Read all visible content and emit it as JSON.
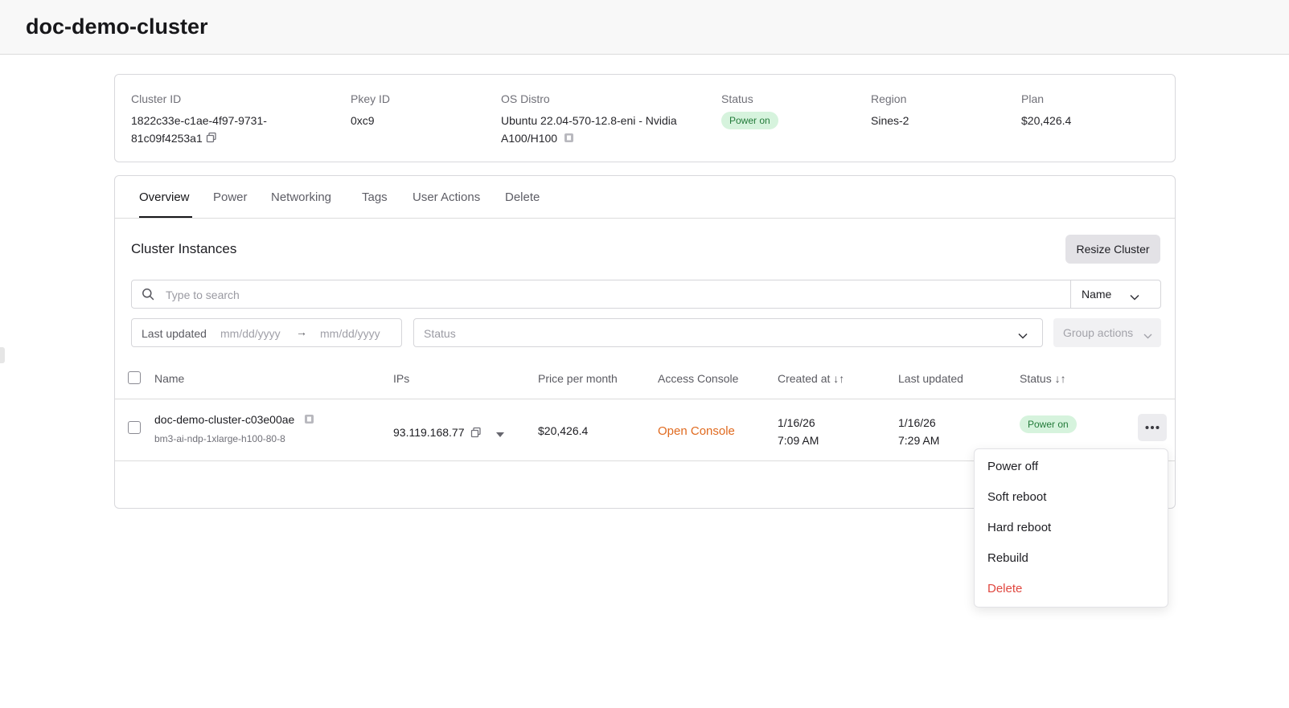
{
  "page": {
    "title": "doc-demo-cluster"
  },
  "cluster_info": {
    "cluster_id_label": "Cluster ID",
    "cluster_id_line1": "1822c33e-c1ae-4f97-9731-",
    "cluster_id_line2": "81c09f4253a1",
    "pkey_label": "Pkey ID",
    "pkey_value": "0xc9",
    "os_label": "OS Distro",
    "os_line1": "Ubuntu 22.04-570-12.8-eni - Nvidia",
    "os_line2": "A100/H100",
    "status_label": "Status",
    "status_value": "Power on",
    "region_label": "Region",
    "region_value": "Sines-2",
    "plan_label": "Plan",
    "plan_value": "$20,426.4"
  },
  "tabs": [
    {
      "label": "Overview",
      "active": true
    },
    {
      "label": "Power"
    },
    {
      "label": "Networking"
    },
    {
      "label": "Tags"
    },
    {
      "label": "User Actions"
    },
    {
      "label": "Delete"
    }
  ],
  "instances": {
    "title": "Cluster Instances",
    "resize_button": "Resize Cluster",
    "search_placeholder": "Type to search",
    "sort_field": "Name",
    "date_filter_label": "Last updated",
    "date_from_placeholder": "mm/dd/yyyy",
    "date_arrow": "→",
    "date_to_placeholder": "mm/dd/yyyy",
    "status_placeholder": "Status",
    "group_actions": "Group actions",
    "columns": {
      "name": "Name",
      "ips": "IPs",
      "price": "Price per month",
      "console": "Access Console",
      "created": "Created at ↓↑",
      "updated": "Last updated",
      "status": "Status ↓↑"
    },
    "rows": [
      {
        "name": "doc-demo-cluster-c03e00ae",
        "plan": "bm3-ai-ndp-1xlarge-h100-80-8",
        "ip": "93.119.168.77",
        "price": "$20,426.4",
        "console": "Open Console",
        "created_date": "1/16/26",
        "created_time": "7:09 AM",
        "updated_date": "1/16/26",
        "updated_time": "7:29 AM",
        "status": "Power on"
      }
    ]
  },
  "row_menu": {
    "items": [
      "Power off",
      "Soft reboot",
      "Hard reboot",
      "Rebuild",
      "Delete"
    ]
  },
  "colors": {
    "accent_orange": "#e06a1f",
    "danger_red": "#e0473f",
    "status_green_bg": "#d6f3dd",
    "status_green_text": "#237b3a"
  }
}
